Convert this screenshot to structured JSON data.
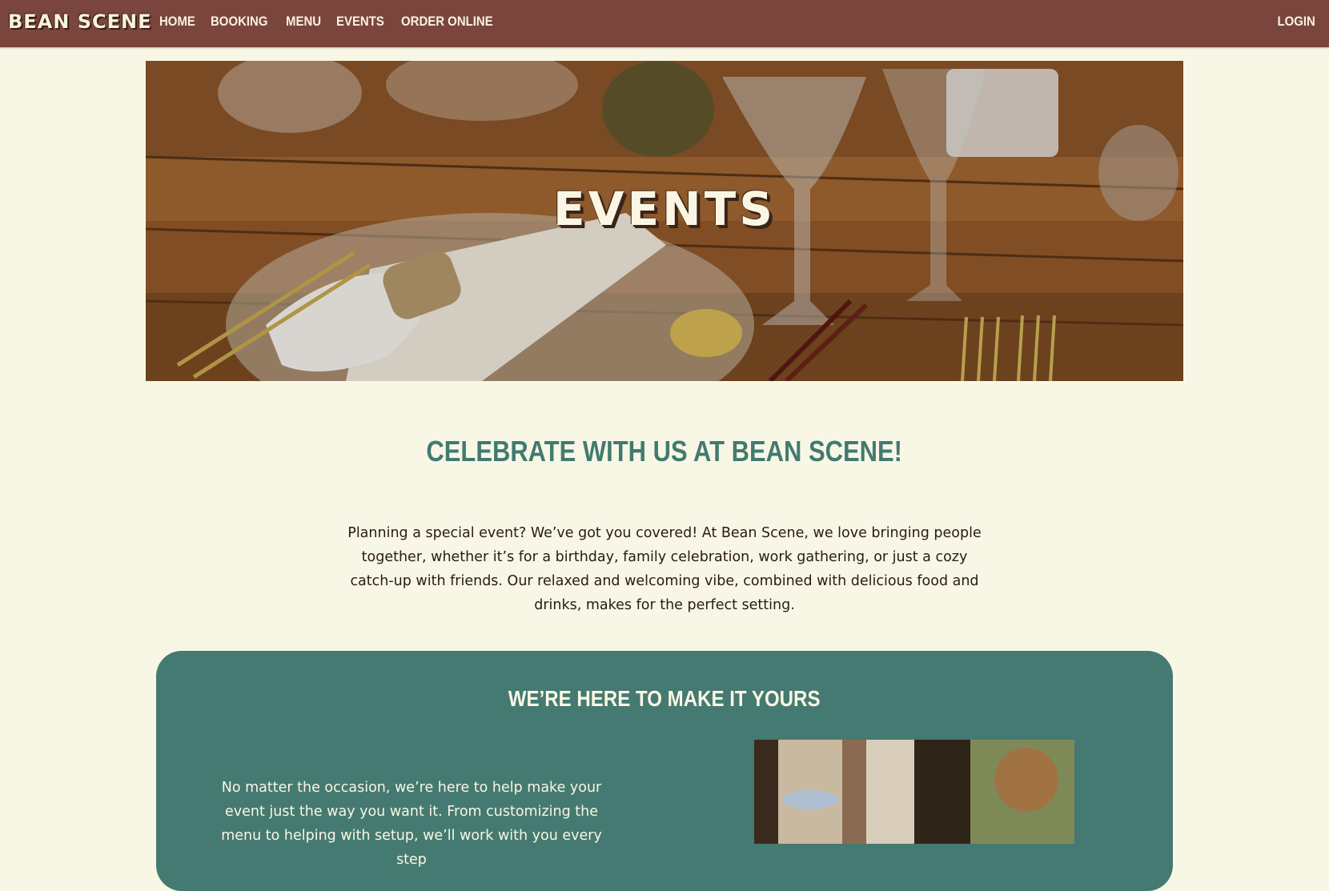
{
  "nav": {
    "brand": "BEAN SCENE",
    "links": [
      "HOME",
      "BOOKING",
      "MENU",
      "EVENTS",
      "ORDER ONLINE"
    ],
    "login": "LOGIN"
  },
  "hero": {
    "title": "EVENTS"
  },
  "celebrate": {
    "heading": "CELEBRATE WITH US AT BEAN SCENE!",
    "body": "Planning a special event? We’ve got you covered! At Bean Scene, we love bringing people together, whether it’s for a birthday, family celebration, work gathering, or just a cozy catch-up with friends. Our relaxed and welcoming vibe, combined with delicious food and drinks, makes for the perfect setting."
  },
  "card": {
    "heading": "WE’RE HERE TO MAKE IT YOURS",
    "body": "No matter the occasion, we’re here to help make your event just the way you want it. From customizing the menu to helping with setup, we’ll work with you every step"
  },
  "colors": {
    "nav_bg": "#7a453c",
    "page_bg": "#f8f7e6",
    "accent_green": "#447a71",
    "heading_green": "#427a70",
    "cream_text": "#fbf6e3"
  }
}
